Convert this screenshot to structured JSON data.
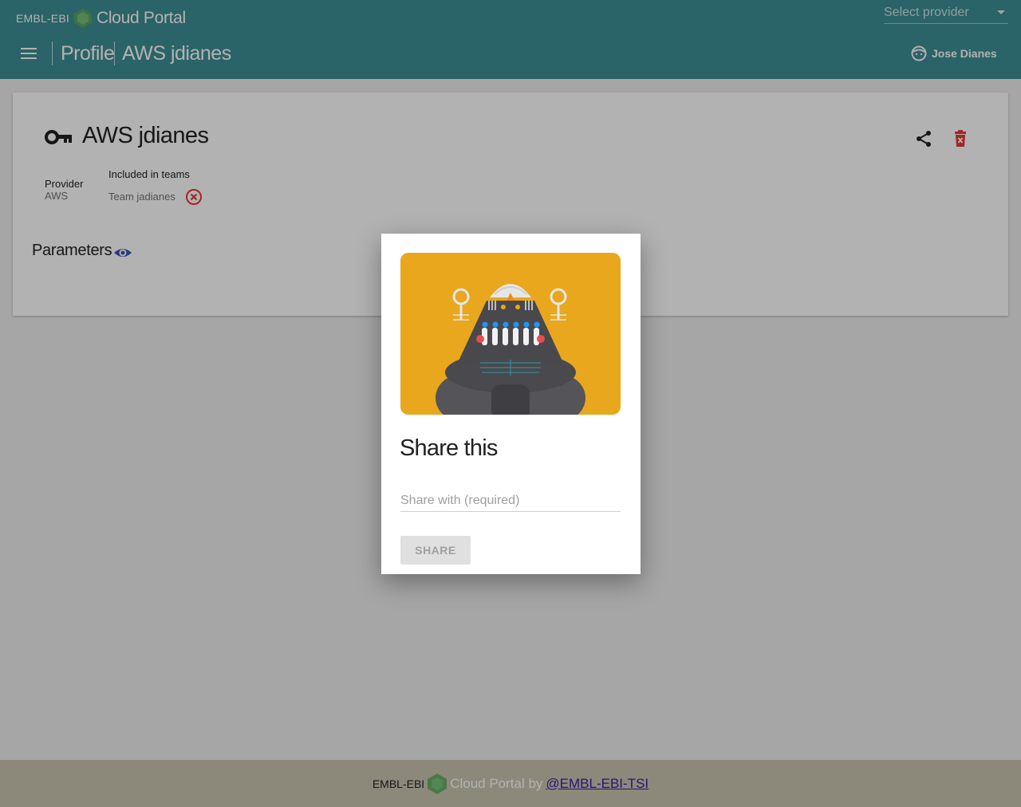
{
  "header": {
    "brand_prefix": "EMBL-EBI",
    "brand_name": "Cloud Portal",
    "provider_placeholder": "Select provider",
    "breadcrumbs": [
      "Profile",
      "AWS jdianes"
    ],
    "user_name": "Jose Dianes"
  },
  "card": {
    "title": "AWS jdianes",
    "provider_label": "Provider",
    "provider_value": "AWS",
    "teams_label": "Included in teams",
    "teams": [
      "Team jadianes"
    ],
    "parameters_label": "Parameters"
  },
  "dialog": {
    "title": "Share this",
    "input_placeholder": "Share with (required)",
    "button_label": "SHARE"
  },
  "footer": {
    "brand_prefix": "EMBL-EBI",
    "text": "Cloud Portal by",
    "link": "@EMBL-EBI-TSI"
  },
  "colors": {
    "header_bg": "#3d8e96",
    "footer_bg": "#c9c5b0",
    "robot_bg": "#e8a71d",
    "danger": "#e53935",
    "eye": "#3f51b5",
    "footer_link": "#3a1ea8"
  }
}
